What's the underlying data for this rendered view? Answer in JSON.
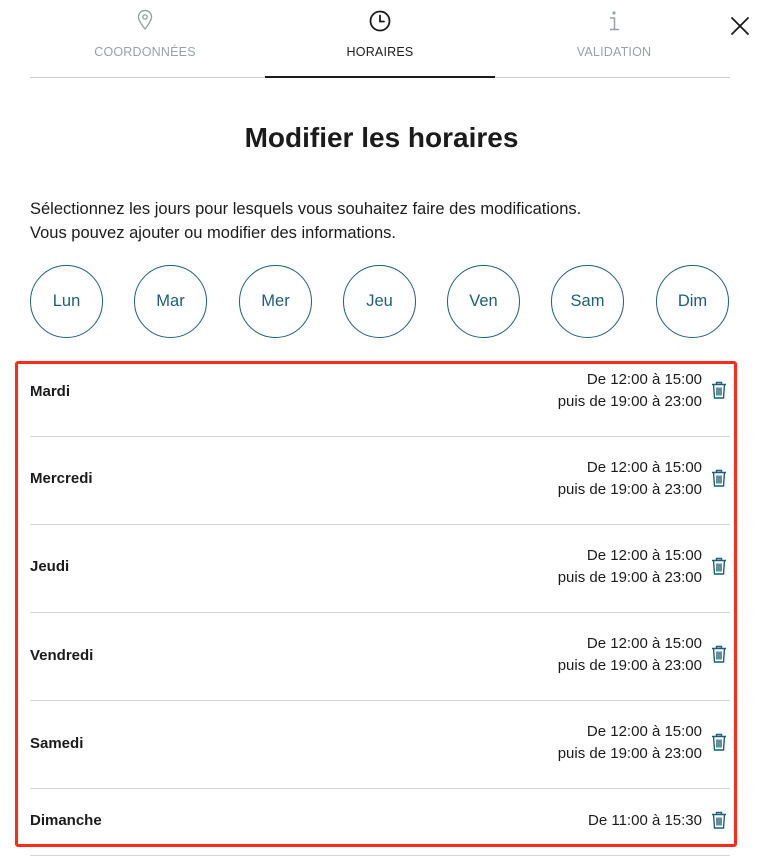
{
  "tabs": [
    {
      "label": "COORDONNÉES",
      "icon": "location-pin-icon",
      "active": false
    },
    {
      "label": "HORAIRES",
      "icon": "clock-icon",
      "active": true
    },
    {
      "label": "VALIDATION",
      "icon": "info-icon",
      "active": false
    }
  ],
  "title": "Modifier les horaires",
  "intro": {
    "line1": "Sélectionnez les jours pour lesquels vous souhaitez faire des modifications.",
    "line2": "Vous pouvez ajouter ou modifier des informations."
  },
  "days": [
    "Lun",
    "Mar",
    "Mer",
    "Jeu",
    "Ven",
    "Sam",
    "Dim"
  ],
  "schedule": [
    {
      "day": "Mardi",
      "line1": "De 12:00 à 15:00",
      "line2": "puis de 19:00 à 23:00"
    },
    {
      "day": "Mercredi",
      "line1": "De 12:00 à 15:00",
      "line2": "puis de 19:00 à 23:00"
    },
    {
      "day": "Jeudi",
      "line1": "De 12:00 à 15:00",
      "line2": "puis de 19:00 à 23:00"
    },
    {
      "day": "Vendredi",
      "line1": "De 12:00 à 15:00",
      "line2": "puis de 19:00 à 23:00"
    },
    {
      "day": "Samedi",
      "line1": "De 12:00 à 15:00",
      "line2": "puis de 19:00 à 23:00"
    },
    {
      "day": "Dimanche",
      "line1": "De 11:00 à 15:30"
    }
  ],
  "colors": {
    "accent": "#1e5f73",
    "highlight": "#ff2a1a",
    "muted": "#9aa0a3"
  }
}
